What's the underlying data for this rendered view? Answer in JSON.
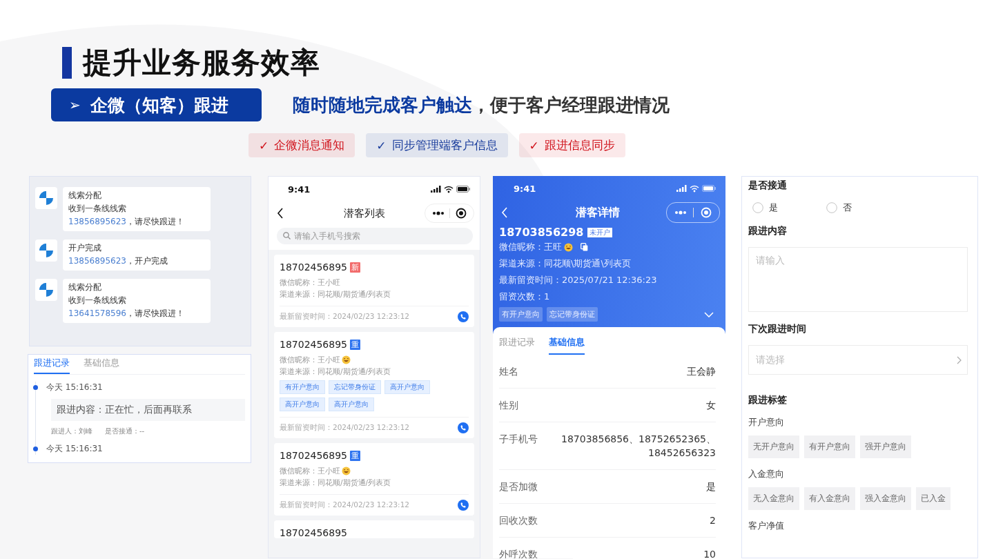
{
  "title": "提升业务服务效率",
  "section_button": {
    "icon": "➢",
    "label": "企微（知客）跟进"
  },
  "tagline": {
    "highlight": "随时随地完成客户触达",
    "rest": "，便于客户经理跟进情况"
  },
  "features": [
    {
      "check": "✓",
      "label": "企微消息通知",
      "color": "#d0121b"
    },
    {
      "check": "✓",
      "label": "同步管理端客户信息",
      "color": "#1a3d9c"
    },
    {
      "check": "✓",
      "label": "跟进信息同步",
      "color": "#d0121b"
    }
  ],
  "chat": {
    "messages": [
      {
        "title": "线索分配",
        "text": "收到一条线线索",
        "phone": "13856895623",
        "suffix": "，请尽快跟进！"
      },
      {
        "title": "开户完成",
        "phone": "13856895623",
        "suffix": "，开户完成"
      },
      {
        "title": "线索分配",
        "text": "收到一条线线索",
        "phone": "13641578596",
        "suffix": "，请尽快跟进！"
      }
    ]
  },
  "followup_card": {
    "tabs": [
      {
        "label": "跟进记录",
        "selected": true
      },
      {
        "label": "基础信息",
        "selected": false
      }
    ],
    "records": [
      {
        "time": "今天 15:16:31",
        "content": "跟进内容：正在忙，后面再联系",
        "person": "跟进人：刘峰",
        "connected": "是否接通：--"
      },
      {
        "time": "今天 15:16:31"
      }
    ]
  },
  "list_screen": {
    "status_time": "9:41",
    "title": "潜客列表",
    "search_placeholder": "请输入手机号搜索",
    "cards": [
      {
        "phone": "18702456895",
        "badge": {
          "text": "新",
          "color": "#f26b6b"
        },
        "nickname": "微信昵称：王小旺",
        "emoji": false,
        "source": "渠道来源：同花顺/期货通/列表页",
        "time": "最新留资时间：2024/02/23 12:23:12"
      },
      {
        "phone": "18702456895",
        "badge": {
          "text": "重",
          "color": "#2f74f0"
        },
        "nickname": "微信昵称：王小旺",
        "emoji": true,
        "source": "渠道来源：同花顺/期货通/列表页",
        "tags": [
          "有开户意向",
          "忘记带身份证",
          "高开户意向",
          "高开户意向",
          "高开户意向"
        ],
        "time": "最新留资时间：2024/02/23 12:23:12"
      },
      {
        "phone": "18702456895",
        "badge": {
          "text": "重",
          "color": "#2f74f0"
        },
        "nickname": "微信昵称：王小旺",
        "emoji": true,
        "source": "渠道来源：同花顺/期货通/列表页",
        "time": "最新留资时间：2024/02/23 12:23:12"
      },
      {
        "phone": "18702456895"
      }
    ]
  },
  "detail_screen": {
    "status_time": "9:41",
    "title": "潜客详情",
    "phone": "18703856298",
    "status_badge": "未开户",
    "nickname": "微信昵称：王旺",
    "emoji": true,
    "source": "渠道来源：同花顺\\期货通\\列表页",
    "time": "最新留资时间：2025/07/21 12:36:23",
    "count": "留资次数：1",
    "tags": [
      "有开户意向",
      "忘记带身份证"
    ],
    "tabs": [
      {
        "label": "跟进记录",
        "selected": false
      },
      {
        "label": "基础信息",
        "selected": true
      }
    ],
    "fields": [
      {
        "label": "姓名",
        "value": "王会静"
      },
      {
        "label": "性别",
        "value": "女"
      },
      {
        "label": "子手机号",
        "value": "18703856856、18752652365、18452656323"
      },
      {
        "label": "是否加微",
        "value": "是"
      },
      {
        "label": "回收次数",
        "value": "2"
      },
      {
        "label": "外呼次数",
        "value": "10"
      }
    ]
  },
  "form": {
    "connected": {
      "label": "是否接通",
      "options": [
        {
          "label": "是",
          "selected": false
        },
        {
          "label": "否",
          "selected": false
        }
      ]
    },
    "content": {
      "label": "跟进内容",
      "placeholder": "请输入"
    },
    "next_time": {
      "label": "下次跟进时间",
      "placeholder": "请选择"
    },
    "tags_title": "跟进标签",
    "tag_groups": [
      {
        "name": "开户意向",
        "tags": [
          {
            "label": "无开户意向",
            "selected": false
          },
          {
            "label": "有开户意向",
            "selected": false
          },
          {
            "label": "强开户意向",
            "selected": false
          }
        ]
      },
      {
        "name": "入金意向",
        "tags": [
          {
            "label": "无入金意向",
            "selected": false
          },
          {
            "label": "有入金意向",
            "selected": false
          },
          {
            "label": "强入金意向",
            "selected": false
          },
          {
            "label": "已入金",
            "selected": false
          }
        ]
      },
      {
        "name": "客户净值"
      }
    ]
  }
}
